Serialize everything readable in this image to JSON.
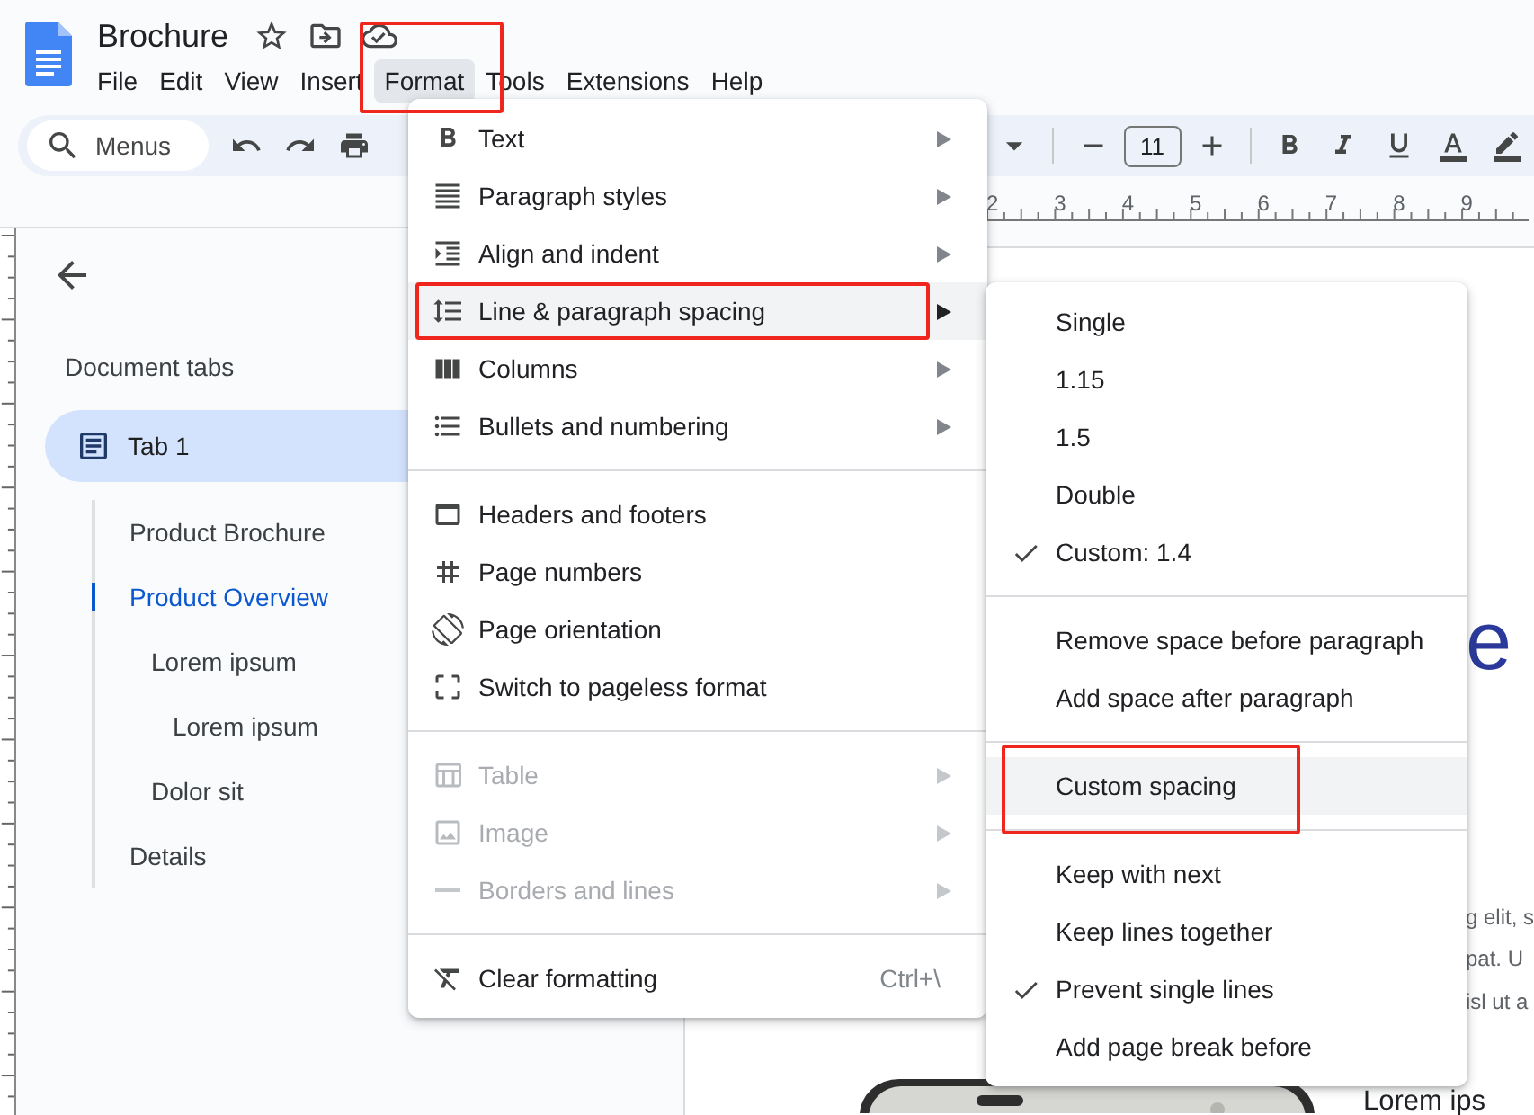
{
  "document_title": "Brochure",
  "menubar": [
    {
      "label": "File",
      "selected": false,
      "framed": false
    },
    {
      "label": "Edit",
      "selected": false,
      "framed": false
    },
    {
      "label": "View",
      "selected": false,
      "framed": false
    },
    {
      "label": "Insert",
      "selected": false,
      "framed": false
    },
    {
      "label": "Format",
      "selected": true,
      "framed": true
    },
    {
      "label": "Tools",
      "selected": false,
      "framed": false
    },
    {
      "label": "Extensions",
      "selected": false,
      "framed": false
    },
    {
      "label": "Help",
      "selected": false,
      "framed": false
    }
  ],
  "toolbar": {
    "search_placeholder": "Menus",
    "font_size": "11"
  },
  "ruler": [
    "2",
    "3",
    "4",
    "5",
    "6",
    "7",
    "8",
    "9"
  ],
  "sidebar": {
    "heading": "Document tabs",
    "tab": {
      "label": "Tab 1",
      "selected": true
    },
    "outline": [
      {
        "label": "Product Brochure",
        "selected": false
      },
      {
        "label": "Product Overview",
        "selected": true,
        "children": [
          {
            "label": "Lorem ipsum",
            "selected": false,
            "children": [
              {
                "label": "Lorem ipsum",
                "selected": false
              }
            ]
          },
          {
            "label": "Dolor sit",
            "selected": false
          }
        ]
      },
      {
        "label": "Details",
        "selected": false
      }
    ]
  },
  "format_menu": [
    [
      {
        "label": "Text",
        "submenu": true,
        "disabled": false,
        "highlighted": false,
        "framed": false
      },
      {
        "label": "Paragraph styles",
        "submenu": true,
        "disabled": false,
        "highlighted": false,
        "framed": false
      },
      {
        "label": "Align and indent",
        "submenu": true,
        "disabled": false,
        "highlighted": false,
        "framed": false
      },
      {
        "label": "Line & paragraph spacing",
        "submenu": true,
        "disabled": false,
        "highlighted": true,
        "framed": true
      },
      {
        "label": "Columns",
        "submenu": true,
        "disabled": false,
        "highlighted": false,
        "framed": false
      },
      {
        "label": "Bullets and numbering",
        "submenu": true,
        "disabled": false,
        "highlighted": false,
        "framed": false
      }
    ],
    [
      {
        "label": "Headers and footers",
        "submenu": false,
        "disabled": false,
        "highlighted": false,
        "framed": false
      },
      {
        "label": "Page numbers",
        "submenu": false,
        "disabled": false,
        "highlighted": false,
        "framed": false
      },
      {
        "label": "Page orientation",
        "submenu": false,
        "disabled": false,
        "highlighted": false,
        "framed": false
      },
      {
        "label": "Switch to pageless format",
        "submenu": false,
        "disabled": false,
        "highlighted": false,
        "framed": false
      }
    ],
    [
      {
        "label": "Table",
        "submenu": true,
        "disabled": true,
        "highlighted": false,
        "framed": false
      },
      {
        "label": "Image",
        "submenu": true,
        "disabled": true,
        "highlighted": false,
        "framed": false
      },
      {
        "label": "Borders and lines",
        "submenu": true,
        "disabled": true,
        "highlighted": false,
        "framed": false
      }
    ],
    [
      {
        "label": "Clear formatting",
        "submenu": false,
        "disabled": false,
        "highlighted": false,
        "framed": false,
        "shortcut": "Ctrl+\\"
      }
    ]
  ],
  "spacing_submenu": [
    [
      {
        "label": "Single",
        "checked": false,
        "highlighted": false,
        "framed": false
      },
      {
        "label": "1.15",
        "checked": false,
        "highlighted": false,
        "framed": false
      },
      {
        "label": "1.5",
        "checked": false,
        "highlighted": false,
        "framed": false
      },
      {
        "label": "Double",
        "checked": false,
        "highlighted": false,
        "framed": false
      },
      {
        "label": "Custom: 1.4",
        "checked": true,
        "highlighted": false,
        "framed": false
      }
    ],
    [
      {
        "label": "Remove space before paragraph",
        "checked": false,
        "highlighted": false,
        "framed": false
      },
      {
        "label": "Add space after paragraph",
        "checked": false,
        "highlighted": false,
        "framed": false
      }
    ],
    [
      {
        "label": "Custom spacing",
        "checked": false,
        "highlighted": true,
        "framed": true
      }
    ],
    [
      {
        "label": "Keep with next",
        "checked": false,
        "highlighted": false,
        "framed": false
      },
      {
        "label": "Keep lines together",
        "checked": false,
        "highlighted": false,
        "framed": false
      },
      {
        "label": "Prevent single lines",
        "checked": true,
        "highlighted": false,
        "framed": false
      },
      {
        "label": "Add page break before",
        "checked": false,
        "highlighted": false,
        "framed": false
      }
    ]
  ],
  "document": {
    "heading": "e",
    "lines": [
      "g elit, s",
      "pat. U",
      "isl ut a"
    ],
    "subheading": "Lorem ips",
    "picture": {
      "kind": "picture"
    }
  }
}
